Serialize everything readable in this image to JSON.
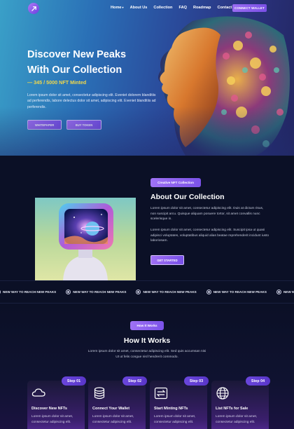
{
  "nav": {
    "links": [
      "Home",
      "About Us",
      "Collection",
      "FAQ",
      "Roadmap",
      "Contact"
    ],
    "connect_label": "CONNECT WALLET"
  },
  "hero": {
    "title_line1": "Discover New Peaks",
    "title_line2": "With Our Collection",
    "subtitle": "— 345 / 5000 NFT Minted",
    "description": "Lorem ipsum dolor sit amet, consectetur adipiscing elit. Eveniet dolorem blanditiis ad perferendis, labore delectus dolor sit amet, adipiscing elit. Eveniet blanditiis ad perferendis.",
    "btn_whitepaper": "WHITEPAPER",
    "btn_buy": "BUY TOKEN"
  },
  "about": {
    "pill": "Creative NFT Collection",
    "title": "About Our Collection",
    "p1": "Lorem ipsum dolor sit amet, consectetur adipiscing elit. Duis at dictum risus, non suscipit arcu. Quisque aliquam posuere tortor, sit amet convallis nunc scelerisque in.",
    "p2": "Lorem ipsum dolor sit amet, consectetur adipiscing elit. Suscipit ipsa ut quasi adipisci voluptates, voluptatibus aliquid alias beatae reprehenderit incidunt iusto laboriosam.",
    "btn": "GET STARTED"
  },
  "marquee": {
    "item": "NEW WAY TO REACH NEW PEAKS",
    "count": 5
  },
  "how": {
    "pill": "How It Works",
    "title": "How It Works",
    "desc": "Lorem ipsum dolor sit amet, consectetur adipiscing elit. Sed quis accumsan nisi Ut ut felis congue nisl hendrerit commodo.",
    "steps": [
      {
        "badge": "Step 01",
        "title": "Discover New NFTs",
        "icon": "cloud-icon",
        "desc": "Lorem ipsum dolor sit amet, consectetur adipiscing elit."
      },
      {
        "badge": "Step 02",
        "title": "Connect Your Wallet",
        "icon": "database-icon",
        "desc": "Lorem ipsum dolor sit amet, consectetur adipiscing elit."
      },
      {
        "badge": "Step 03",
        "title": "Start Minting NFTs",
        "icon": "swap-icon",
        "desc": "Lorem ipsum dolor sit amet, consectetur adipiscing elit."
      },
      {
        "badge": "Step 04",
        "title": "List NFTs for Sale",
        "icon": "globe-icon",
        "desc": "Lorem ipsum dolor sit amet, consectetur adipiscing elit."
      }
    ]
  },
  "colors": {
    "accent": "#8a5cf0",
    "highlight": "#f2d84a",
    "background": "#0b1026"
  }
}
